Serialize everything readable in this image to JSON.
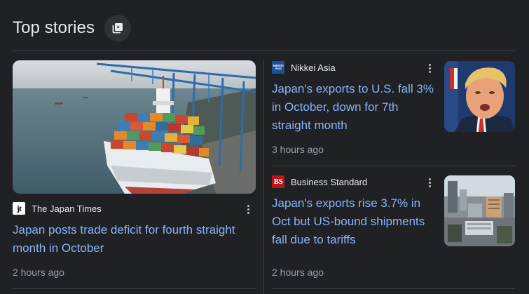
{
  "header": {
    "title": "Top stories",
    "icon": "stories-stack-icon"
  },
  "stories": [
    {
      "source": "The Japan Times",
      "logo_text": "jt",
      "headline": "Japan posts trade deficit for fourth straight month in October",
      "time": "2 hours ago",
      "image": "container-ship-port"
    },
    {
      "source": "Nikkei Asia",
      "logo_text": "NIKKEI Asia",
      "headline": "Japan's exports to U.S. fall 3% in October, down for 7th straight month",
      "time": "3 hours ago",
      "image": "politician-portrait"
    },
    {
      "source": "Business Standard",
      "logo_text": "BS",
      "headline": "Japan's exports rise 3.7% in Oct but US-bound shipments fall due to tariffs",
      "time": "2 hours ago",
      "image": "tokyo-skyline"
    }
  ],
  "colors": {
    "background": "#202124",
    "link": "#8ab4f8",
    "meta": "#9aa0a6",
    "divider": "#3c4043"
  }
}
